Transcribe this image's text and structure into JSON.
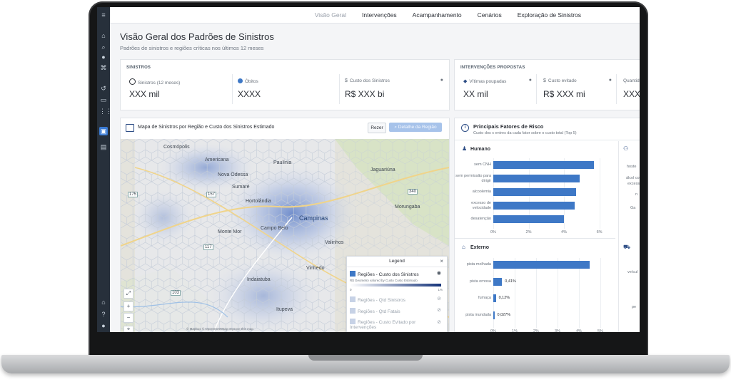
{
  "nav": {
    "tabs": [
      {
        "label": "Visão Geral",
        "active": true
      },
      {
        "label": "Intervenções",
        "active": false
      },
      {
        "label": "Acampanhamento",
        "active": false
      },
      {
        "label": "Cenários",
        "active": false
      },
      {
        "label": "Exploração de Sinistros",
        "active": false
      }
    ]
  },
  "page": {
    "title": "Visão Geral dos Padrões de Sinistros",
    "subtitle": "Padrões de sinistros e regiões críticas nos últimos 12 meses"
  },
  "sinistros_panel": {
    "header": "SINISTROS",
    "kpis": [
      {
        "label": "Sinistros (12 meses)",
        "value": "XXX mil",
        "icon": "clock-icon"
      },
      {
        "label": "Óbitos",
        "value": "XXXX",
        "icon": "badge-icon"
      },
      {
        "label": "Custo dos Sinistros",
        "value": "R$ XXX bi",
        "icon": "dollar-icon"
      }
    ]
  },
  "intervencoes_panel": {
    "header": "INTERVENÇÕES PROPOSTAS",
    "kpis": [
      {
        "label": "Vítimas poupadas",
        "value": "XX mil",
        "icon": "shield-icon"
      },
      {
        "label": "Custo evitado",
        "value": "R$ XXX mi",
        "icon": "dollar-icon"
      },
      {
        "label": "Quantid",
        "value": "XXX",
        "icon": ""
      }
    ]
  },
  "map_panel": {
    "title": "Mapa de Sinistros por Região e Custo dos Sinistros Estimado",
    "reset_label": "Rezer",
    "detail_button": "Detalhe da Região",
    "cities": [
      "Americana",
      "Paulínia",
      "Nova Odessa",
      "Sumaré",
      "Hortolândia",
      "Campinas",
      "Valinhos",
      "Monte Mor",
      "Campo Belo",
      "Indaiatuba",
      "Morungaba",
      "Itupeva",
      "Vinhedo",
      "Jaguariúna",
      "Cosmópolis"
    ],
    "road_labels": [
      "175",
      "157",
      "340",
      "117",
      "103"
    ],
    "attribution": "© Mapbox © OpenStreetMap Improve this map",
    "legend": {
      "title": "Legend",
      "layers": [
        {
          "label": "Regiões - Custo dos Sinistros",
          "active": true
        },
        {
          "label": "Regiões - Qtd Sinistros",
          "active": false
        },
        {
          "label": "Regiões - Qtd Fatais",
          "active": false
        },
        {
          "label": "Regiões - Custo Evitado por Intervenções",
          "active": false
        }
      ],
      "gradient_caption": "R$ Geometry valored by Custo Custo Estimado",
      "gradient_min": "0",
      "gradient_max": "1%"
    }
  },
  "risk_panel": {
    "title": "Principais Fatores de Risco",
    "subtitle": "Custo dos x entres da cada fator sobre o custo total (Top 5)",
    "cut_column_labels_human": [
      "hoste",
      "álcol co",
      "excess",
      "n",
      "Ga"
    ],
    "cut_column_labels_external": [
      "veícul",
      "",
      "pe"
    ]
  },
  "chart_data": [
    {
      "type": "bar",
      "title": "Humano",
      "orientation": "horizontal",
      "categories": [
        "sem CNH",
        "sem permissão para dirigir",
        "alcoolemia",
        "excesso de velocidade",
        "desatenção"
      ],
      "values": [
        5.7,
        4.9,
        4.7,
        4.6,
        4.0
      ],
      "x_ticks": [
        "0%",
        "2%",
        "4%",
        "6%"
      ],
      "xlim": [
        0,
        6.3
      ]
    },
    {
      "type": "bar",
      "title": "Externo",
      "orientation": "horizontal",
      "categories": [
        "pista molhada",
        "pista ornosa",
        "fumaça",
        "pista inundada"
      ],
      "values": [
        4.5,
        0.41,
        0.12,
        0.027
      ],
      "data_labels": [
        "",
        "0,41%",
        "0,12%",
        "0,027%"
      ],
      "x_ticks": [
        "0%",
        "1%",
        "2%",
        "3%",
        "4%",
        "5%"
      ],
      "xlim": [
        0,
        5.2
      ]
    }
  ]
}
